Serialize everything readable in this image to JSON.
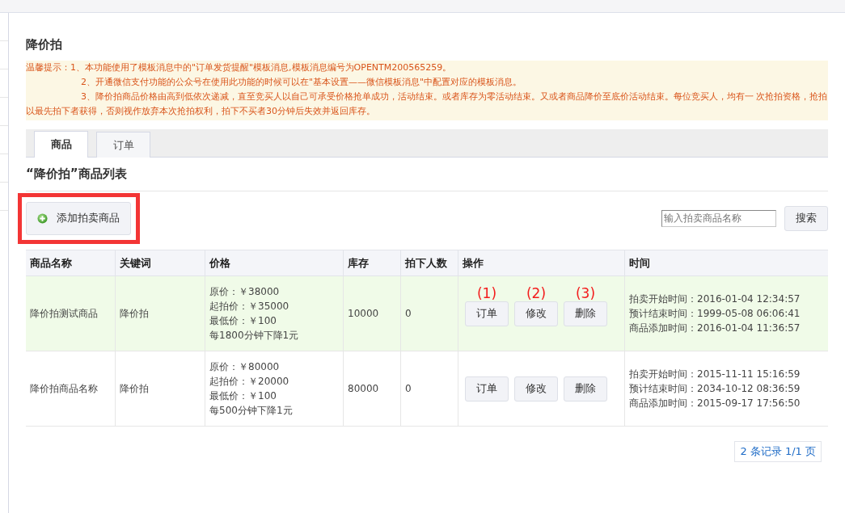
{
  "page_title": "降价拍",
  "notice": {
    "label": "温馨提示：",
    "items": [
      "1、本功能使用了模板消息中的\"订单发货提醒\"模板消息,模板消息编号为OPENTM200565259。",
      "2、开通微信支付功能的公众号在使用此功能的时候可以在\"基本设置——微信模板消息\"中配置对应的模板消息。",
      "3、降价拍商品价格由高到低依次递减，直至竞买人以自己可承受价格抢单成功，活动结束。或者库存为零活动结束。又或者商品降价至底价活动结束。每位竞买人，均有一 次抢拍资格，抢拍以最先拍下者获得，否则视作放弃本次抢拍权利，拍下不买者30分钟后失效并返回库存。"
    ]
  },
  "tabs": [
    {
      "label": "商品",
      "selected": true
    },
    {
      "label": "订单",
      "selected": false
    }
  ],
  "section_title": "“降价拍”商品列表",
  "add_button": {
    "label": "添加拍卖商品",
    "highlighted": true
  },
  "search": {
    "placeholder": "输入拍卖商品名称",
    "button": "搜索"
  },
  "table": {
    "columns": [
      "商品名称",
      "关键词",
      "价格",
      "库存",
      "拍下人数",
      "操作",
      "时间"
    ],
    "rows": [
      {
        "selected": true,
        "name": "降价拍测试商品",
        "keyword": "降价拍",
        "price": [
          "原价：￥38000",
          "起拍价：￥35000",
          "最低价：￥100",
          "每1800分钟下降1元"
        ],
        "stock": "10000",
        "buyers": "0",
        "actions": [
          {
            "label": "订单",
            "marker": "(1)"
          },
          {
            "label": "修改",
            "marker": "(2)"
          },
          {
            "label": "删除",
            "marker": "(3)"
          }
        ],
        "times": [
          "拍卖开始时间：2016-01-04 12:34:57",
          "预计结束时间：1999-05-08 06:06:41",
          "商品添加时间：2016-01-04 11:36:57"
        ]
      },
      {
        "selected": false,
        "name": "降价拍商品名称",
        "keyword": "降价拍",
        "price": [
          "原价：￥80000",
          "起拍价：￥20000",
          "最低价：￥100",
          "每500分钟下降1元"
        ],
        "stock": "80000",
        "buyers": "0",
        "actions": [
          {
            "label": "订单"
          },
          {
            "label": "修改"
          },
          {
            "label": "删除"
          }
        ],
        "times": [
          "拍卖开始时间：2015-11-11 15:16:59",
          "预计结束时间：2034-10-12 08:36:59",
          "商品添加时间：2015-09-17 17:56:50"
        ]
      }
    ]
  },
  "pager": "2 条记录 1/1 页"
}
